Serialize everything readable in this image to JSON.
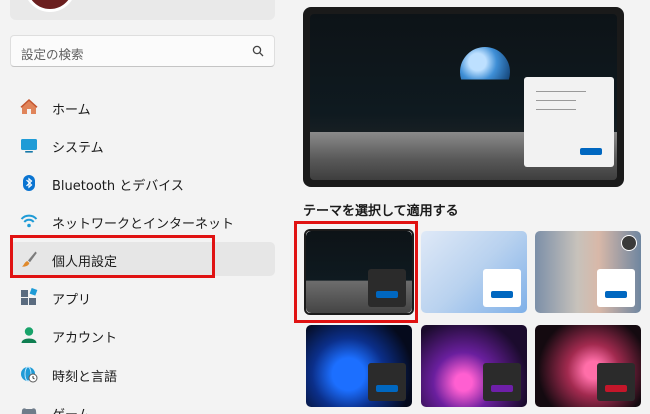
{
  "search": {
    "placeholder": "設定の検索"
  },
  "nav": [
    {
      "label": "ホーム",
      "icon": "home-icon"
    },
    {
      "label": "システム",
      "icon": "system-icon"
    },
    {
      "label": "Bluetooth とデバイス",
      "icon": "bluetooth-icon"
    },
    {
      "label": "ネットワークとインターネット",
      "icon": "wifi-icon"
    },
    {
      "label": "個人用設定",
      "icon": "paintbrush-icon",
      "selected": true
    },
    {
      "label": "アプリ",
      "icon": "apps-icon"
    },
    {
      "label": "アカウント",
      "icon": "account-icon"
    },
    {
      "label": "時刻と言語",
      "icon": "globe-clock-icon"
    },
    {
      "label": "ゲーム",
      "icon": "game-icon"
    }
  ],
  "themes_section": {
    "title": "テーマを選択して適用する"
  },
  "themes": [
    {
      "id": "t1",
      "card_color": "#2b2b2b",
      "button_color": "#0067c0",
      "selected": true
    },
    {
      "id": "t2",
      "card_color": "#ffffff",
      "button_color": "#0067c0"
    },
    {
      "id": "t3",
      "card_color": "#ffffff",
      "button_color": "#0067c0",
      "badge_icon": "theme-mode-icon"
    },
    {
      "id": "t4",
      "card_color": "#2b2b2b",
      "button_color": "#0067c0"
    },
    {
      "id": "t5",
      "card_color": "#2b2b2b",
      "button_color": "#6e1fa8"
    },
    {
      "id": "t6",
      "card_color": "#2b2b2b",
      "button_color": "#c4162a"
    }
  ],
  "colors": {
    "accent": "#0067c0",
    "highlight_frame": "#e01212"
  }
}
